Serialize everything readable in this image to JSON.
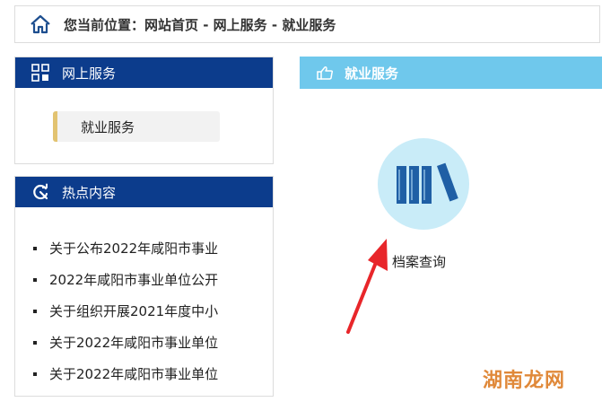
{
  "breadcrumb": {
    "text": "您当前位置：网站首页 - 网上服务 - 就业服务"
  },
  "online_service": {
    "title": "网上服务",
    "items": [
      {
        "label": "就业服务"
      }
    ]
  },
  "hot_content": {
    "title": "热点内容",
    "items": [
      {
        "label": "关于公布2022年咸阳市事业"
      },
      {
        "label": "2022年咸阳市事业单位公开"
      },
      {
        "label": "关于组织开展2021年度中小"
      },
      {
        "label": "关于2022年咸阳市事业单位"
      },
      {
        "label": "关于2022年咸阳市事业单位"
      }
    ]
  },
  "employment": {
    "title": "就业服务",
    "service_label": "档案查询"
  },
  "watermark": {
    "text": "湖南龙网"
  },
  "colors": {
    "navy_header": "#0c3c8c",
    "light_blue_header": "#6fc8ec",
    "icon_circle": "#c9ecf8",
    "book_blue": "#1f5fa5",
    "accent_gold": "#e2c371",
    "arrow_red": "#e8262a"
  }
}
